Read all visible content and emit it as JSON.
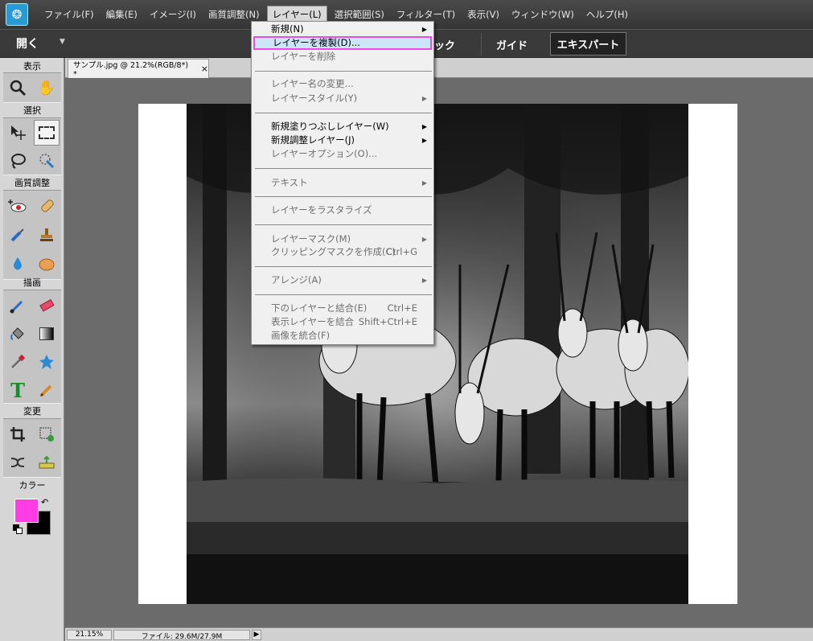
{
  "menubar": {
    "items": [
      "ファイル(F)",
      "編集(E)",
      "イメージ(I)",
      "画質調整(N)",
      "レイヤー(L)",
      "選択範囲(S)",
      "フィルター(T)",
      "表示(V)",
      "ウィンドウ(W)",
      "ヘルプ(H)"
    ],
    "active_index": 4
  },
  "optionsbar": {
    "open_label": "開く",
    "mode_quick_partial": "ック",
    "mode_guide": "ガイド",
    "mode_expert": "エキスパート"
  },
  "toolbox": {
    "sections": [
      "表示",
      "選択",
      "画質調整",
      "描画",
      "変更",
      "カラー"
    ]
  },
  "colors": {
    "foreground": "#ff3ce6",
    "background": "#000000",
    "accent_highlight": "#e64ee6"
  },
  "document": {
    "tab_title": "サンプル.jpg @ 21.2%(RGB/8*) *",
    "close_glyph": "×"
  },
  "status": {
    "zoom": "21.15%",
    "file": "ファイル: 29.6M/27.9M"
  },
  "layer_menu": {
    "items": [
      {
        "label": "新規(N)",
        "disabled": false,
        "submenu": true
      },
      {
        "label": "レイヤーを複製(D)...",
        "disabled": false,
        "highlighted": true
      },
      {
        "label": "レイヤーを削除",
        "disabled": true
      },
      {
        "label": "レイヤー名の変更...",
        "disabled": true
      },
      {
        "label": "レイヤースタイル(Y)",
        "disabled": true,
        "submenu": true
      },
      {
        "label": "新規塗りつぶしレイヤー(W)",
        "disabled": false,
        "submenu": true
      },
      {
        "label": "新規調整レイヤー(J)",
        "disabled": false,
        "submenu": true
      },
      {
        "label": "レイヤーオプション(O)...",
        "disabled": true
      },
      {
        "label": "テキスト",
        "disabled": true,
        "submenu": true
      },
      {
        "label": "レイヤーをラスタライズ",
        "disabled": true
      },
      {
        "label": "レイヤーマスク(M)",
        "disabled": true,
        "submenu": true
      },
      {
        "label": "クリッピングマスクを作成(C)",
        "shortcut": "Ctrl+G",
        "disabled": true
      },
      {
        "label": "アレンジ(A)",
        "disabled": true,
        "submenu": true
      },
      {
        "label": "下のレイヤーと結合(E)",
        "shortcut": "Ctrl+E",
        "disabled": true
      },
      {
        "label": "表示レイヤーを結合",
        "shortcut": "Shift+Ctrl+E",
        "disabled": true
      },
      {
        "label": "画像を統合(F)",
        "disabled": true
      }
    ]
  }
}
